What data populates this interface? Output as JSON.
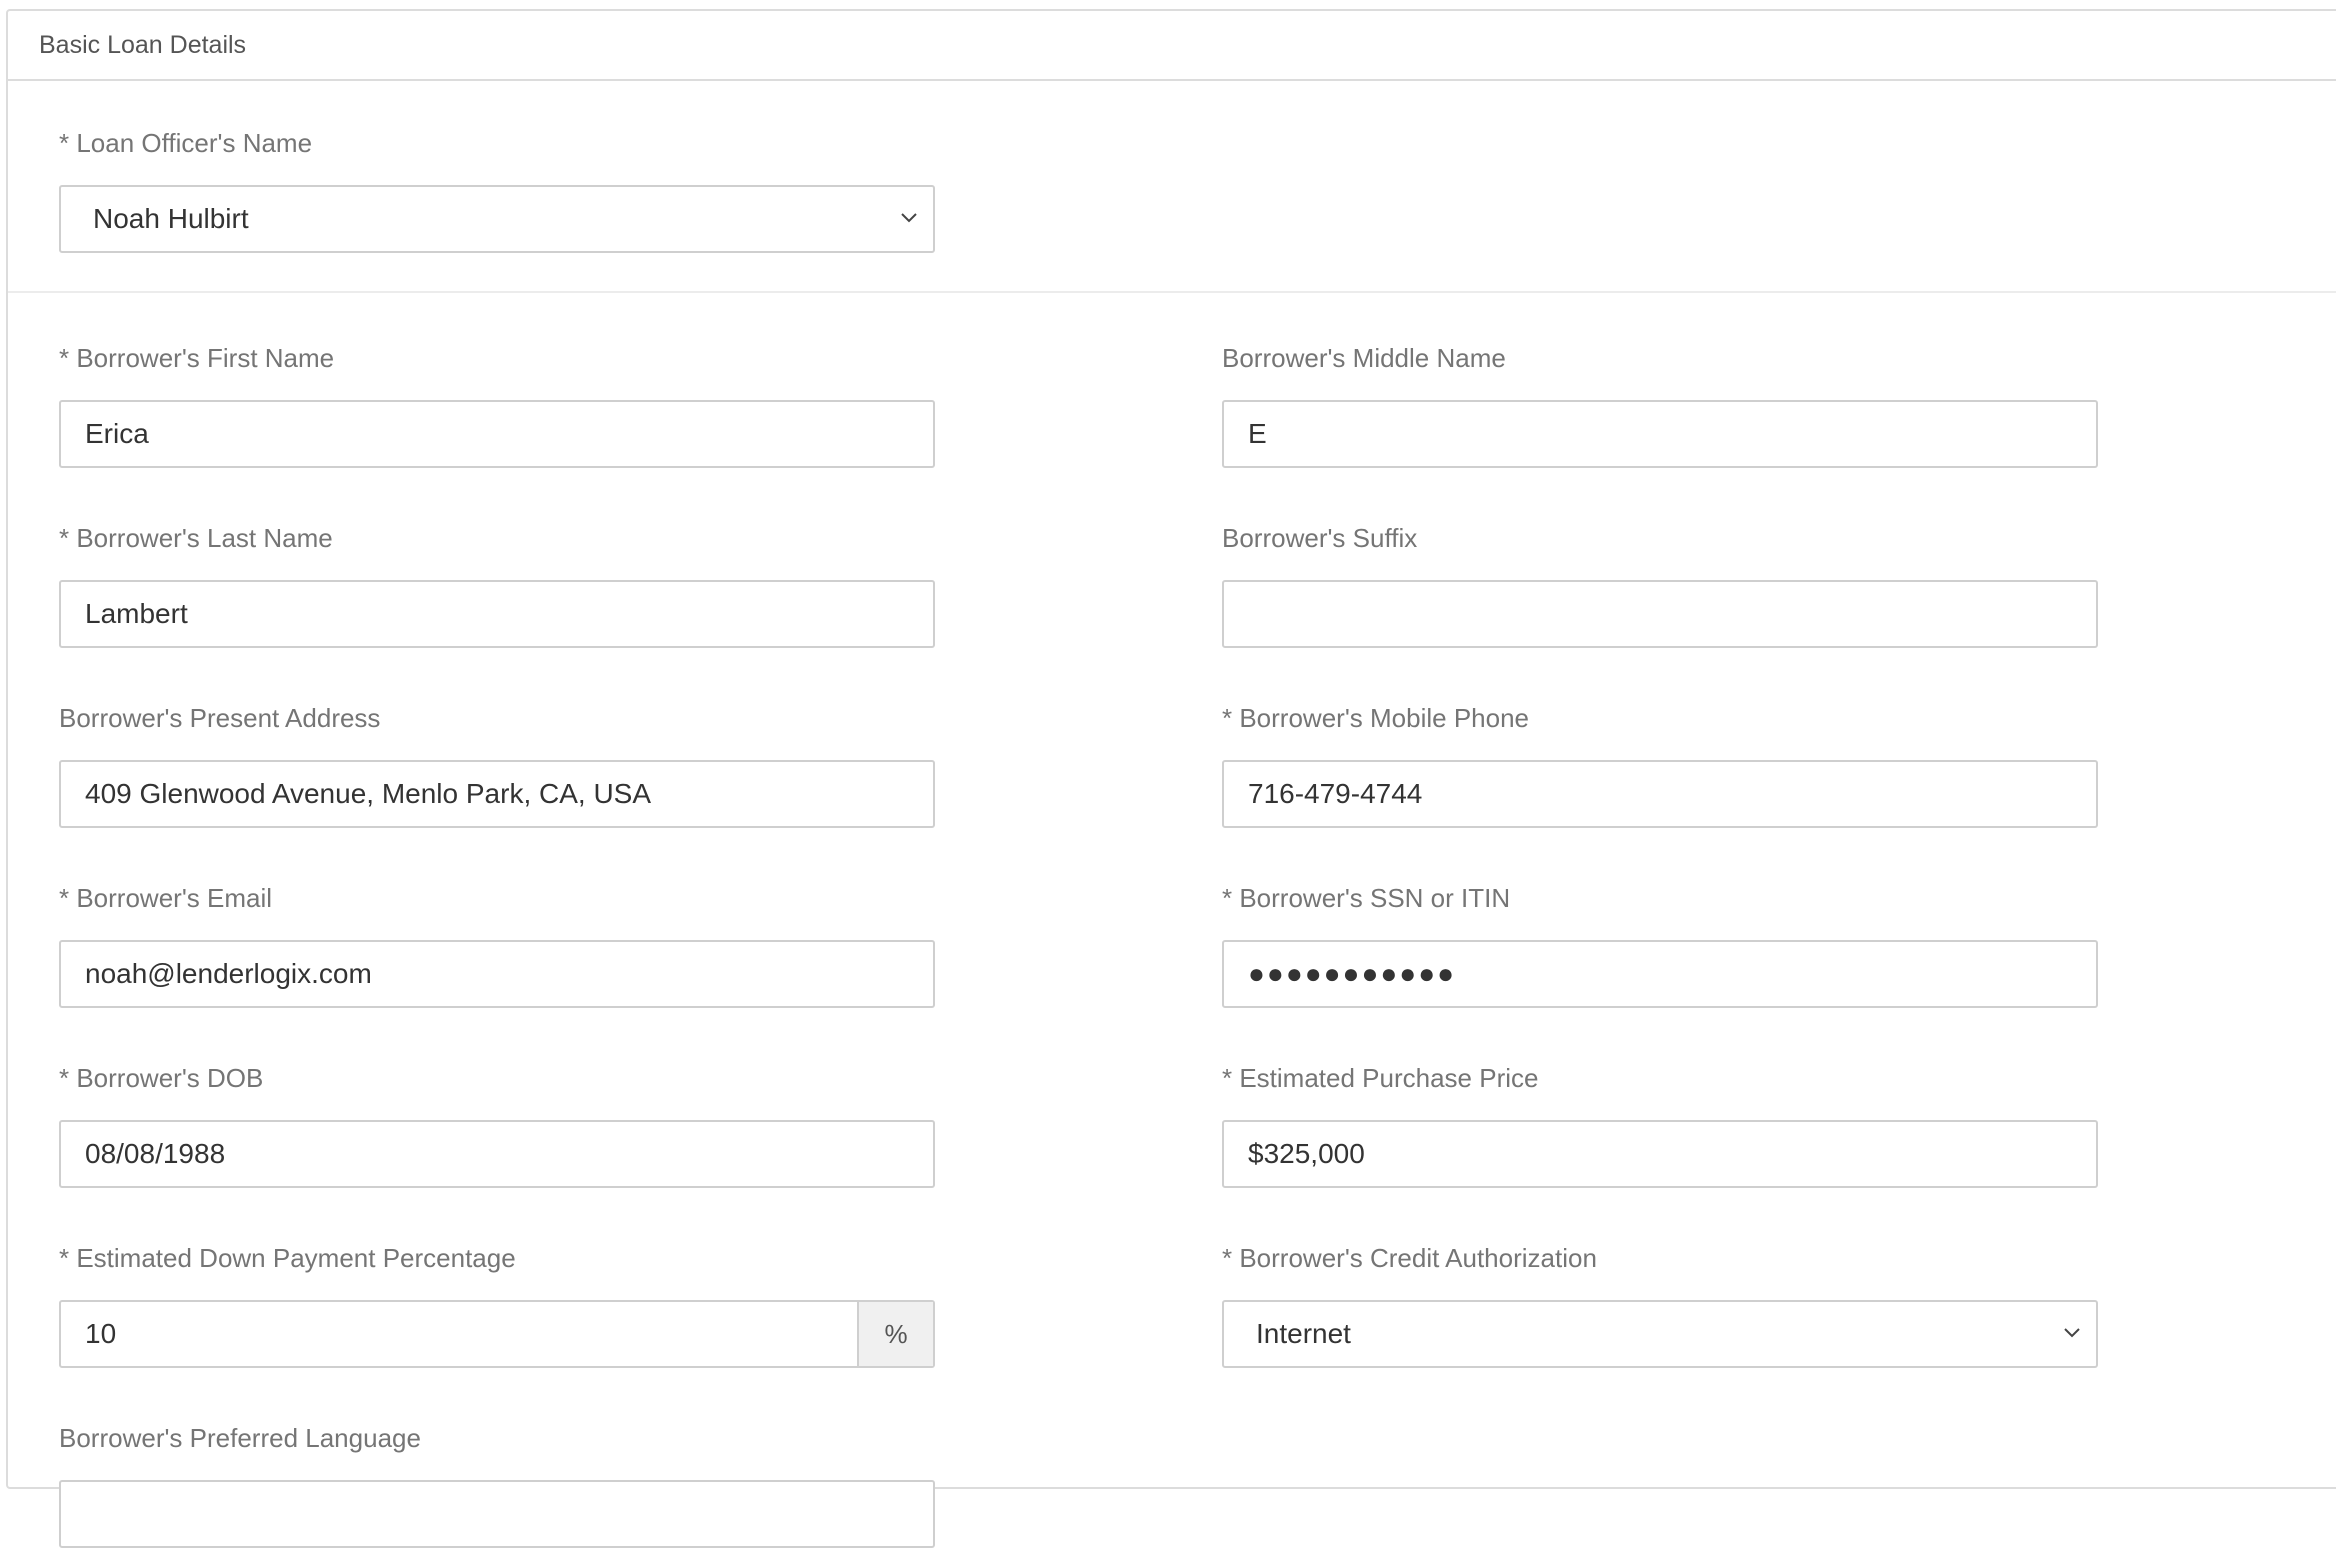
{
  "panel": {
    "title": "Basic Loan Details"
  },
  "officer": {
    "label": "* Loan Officer's Name",
    "value": "Noah Hulbirt"
  },
  "fields": {
    "first_name": {
      "label": "* Borrower's First Name",
      "value": "Erica"
    },
    "middle_name": {
      "label": "Borrower's Middle Name",
      "value": "E"
    },
    "last_name": {
      "label": "* Borrower's Last Name",
      "value": "Lambert"
    },
    "suffix": {
      "label": "Borrower's Suffix",
      "value": ""
    },
    "address": {
      "label": "Borrower's Present Address",
      "value": "409 Glenwood Avenue, Menlo Park, CA, USA"
    },
    "mobile_phone": {
      "label": "* Borrower's Mobile Phone",
      "value": "716-479-4744"
    },
    "email": {
      "label": "* Borrower's Email",
      "value": "noah@lenderlogix.com"
    },
    "ssn": {
      "label": "* Borrower's SSN or ITIN",
      "value": "●●●●●●●●●●●"
    },
    "dob": {
      "label": "* Borrower's DOB",
      "value": "08/08/1988"
    },
    "purchase_price": {
      "label": "* Estimated Purchase Price",
      "value": "$325,000"
    },
    "down_payment": {
      "label": "* Estimated Down Payment Percentage",
      "value": "10",
      "addon": "%"
    },
    "credit_auth": {
      "label": "* Borrower's Credit Authorization",
      "value": "Internet"
    },
    "language": {
      "label": "Borrower's Preferred Language"
    }
  }
}
